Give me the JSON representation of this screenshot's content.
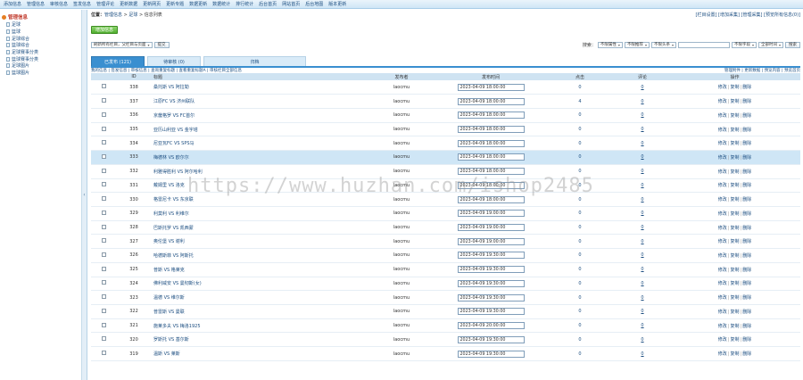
{
  "topnav": [
    "添加信息",
    "管理信息",
    "审核信息",
    "签发信息",
    "管理评论",
    "更新数据",
    "更新网页",
    "更新专题",
    "数据更新",
    "数据统计",
    "排行统计",
    "后台首页",
    "网站首页",
    "后台地图",
    "版本更新"
  ],
  "sidebar": {
    "root": "管理信息",
    "items": [
      "足球",
      "篮球",
      "足球综合",
      "篮球综合",
      "足球赛事分类",
      "篮球赛事分类",
      "足球图片",
      "篮球图片"
    ]
  },
  "breadcrumb": {
    "prefix": "位置：",
    "path1": "管理信息",
    "sep1": " > ",
    "path2": "足球",
    "sep2": " > ",
    "current": "信息列表"
  },
  "quick_links": "[栏目设置] [增加采集] [管理采集] [预览所有信息(0)]",
  "actions": {
    "add_label": "增加信息"
  },
  "filter": {
    "left_select": "刷新所有栏目，父栏目与页面",
    "left_button": "提交",
    "search_label": "搜索：",
    "sel1": "不限属性",
    "sel2": "不限推荐",
    "sel3": "不限头条",
    "sel4": "不限字段",
    "sel5": "全部时间",
    "search_button": "搜索"
  },
  "tabs": [
    {
      "label": "已发布 (121)",
      "active": true
    },
    {
      "label": "待审核 (0)",
      "active": false
    },
    {
      "label": "归档",
      "active": false
    }
  ],
  "sub_links_left": "我的信息 | 签发信息 | 审核信息 | 查询重复标题 | 查看重复标题A | 审核栏目全部信息",
  "sub_links_right": "管理附件 | 更新数据 | 预览内容 | 预览首页",
  "columns": [
    "",
    "ID",
    "标题",
    "发布者",
    "发布时间",
    "点击",
    "评论",
    "操作"
  ],
  "ops": {
    "edit": "修改",
    "copy": "复制",
    "delete": "删除",
    "sep": "|"
  },
  "rows": [
    {
      "id": "338",
      "title": "桑托斯 VS 阿拉勒",
      "author": "laocmu",
      "time": "2023-04-09 18:00:00",
      "clicks": "0",
      "comments": "0",
      "highlight": false
    },
    {
      "id": "337",
      "title": "江原FC VS 济州联队",
      "author": "laocmu",
      "time": "2023-04-09 18:00:00",
      "clicks": "4",
      "comments": "0",
      "highlight": false
    },
    {
      "id": "336",
      "title": "京畿格罗 VS FC首尔",
      "author": "laocmu",
      "time": "2023-04-09 18:00:00",
      "clicks": "0",
      "comments": "0",
      "highlight": false
    },
    {
      "id": "335",
      "title": "亚历山利亚 VS 金字塔",
      "author": "laocmu",
      "time": "2023-04-09 18:00:00",
      "clicks": "0",
      "comments": "0",
      "highlight": false
    },
    {
      "id": "334",
      "title": "尼亚瓦FC VS SPS马",
      "author": "laocmu",
      "time": "2023-04-09 18:00:00",
      "clicks": "0",
      "comments": "0",
      "highlight": false
    },
    {
      "id": "333",
      "title": "梅德林 VS 欧尔尔",
      "author": "laocmu",
      "time": "2023-04-09 18:00:00",
      "clicks": "0",
      "comments": "0",
      "highlight": true
    },
    {
      "id": "332",
      "title": "利雅得胜利 VS 阿尔哈利",
      "author": "laocmu",
      "time": "2023-04-09 18:00:00",
      "clicks": "0",
      "comments": "0",
      "highlight": false
    },
    {
      "id": "331",
      "title": "戴姆里 VS 洛克",
      "author": "laocmu",
      "time": "2023-04-09 18:00:00",
      "clicks": "0",
      "comments": "0",
      "highlight": false
    },
    {
      "id": "330",
      "title": "格雷尼卡 VS 东京联",
      "author": "laocmu",
      "time": "2023-04-09 18:00:00",
      "clicks": "0",
      "comments": "0",
      "highlight": false
    },
    {
      "id": "329",
      "title": "利莫利 VS 利维尔",
      "author": "laocmu",
      "time": "2023-04-09 19:00:00",
      "clicks": "0",
      "comments": "0",
      "highlight": false
    },
    {
      "id": "328",
      "title": "巴斯托罗 VS 凯西蒙",
      "author": "laocmu",
      "time": "2023-04-09 19:00:00",
      "clicks": "0",
      "comments": "0",
      "highlight": false
    },
    {
      "id": "327",
      "title": "奥伦堡 VS 谢利",
      "author": "laocmu",
      "time": "2023-04-09 19:00:00",
      "clicks": "0",
      "comments": "0",
      "highlight": false
    },
    {
      "id": "326",
      "title": "哈德斯菲 VS 阿斯托",
      "author": "laocmu",
      "time": "2023-04-09 19:30:00",
      "clicks": "0",
      "comments": "0",
      "highlight": false
    },
    {
      "id": "325",
      "title": "普斯 VS 格莱克",
      "author": "laocmu",
      "time": "2023-04-09 19:30:00",
      "clicks": "0",
      "comments": "0",
      "highlight": false
    },
    {
      "id": "324",
      "title": "佛利威安 VS 曼彻斯(女)",
      "author": "laocmu",
      "time": "2023-04-09 19:30:00",
      "clicks": "0",
      "comments": "0",
      "highlight": false
    },
    {
      "id": "323",
      "title": "温德 VS 维尔斯",
      "author": "laocmu",
      "time": "2023-04-09 19:30:00",
      "clicks": "0",
      "comments": "0",
      "highlight": false
    },
    {
      "id": "322",
      "title": "普雷斯 VS 曼联",
      "author": "laocmu",
      "time": "2023-04-09 19:30:00",
      "clicks": "0",
      "comments": "0",
      "highlight": false
    },
    {
      "id": "321",
      "title": "施莱多夫 VS 梅洛1925",
      "author": "laocmu",
      "time": "2023-04-09 20:00:00",
      "clicks": "0",
      "comments": "0",
      "highlight": false
    },
    {
      "id": "320",
      "title": "罗斯托 VS 基尔斯",
      "author": "laocmu",
      "time": "2023-04-09 19:30:00",
      "clicks": "0",
      "comments": "0",
      "highlight": false
    },
    {
      "id": "319",
      "title": "温斯 VS 莱斯",
      "author": "laocmu",
      "time": "2023-04-09 19:30:00",
      "clicks": "0",
      "comments": "0",
      "highlight": false
    }
  ],
  "watermark": "https://www.huzhan.com/ishop2485",
  "splitter_glyph": "‹"
}
